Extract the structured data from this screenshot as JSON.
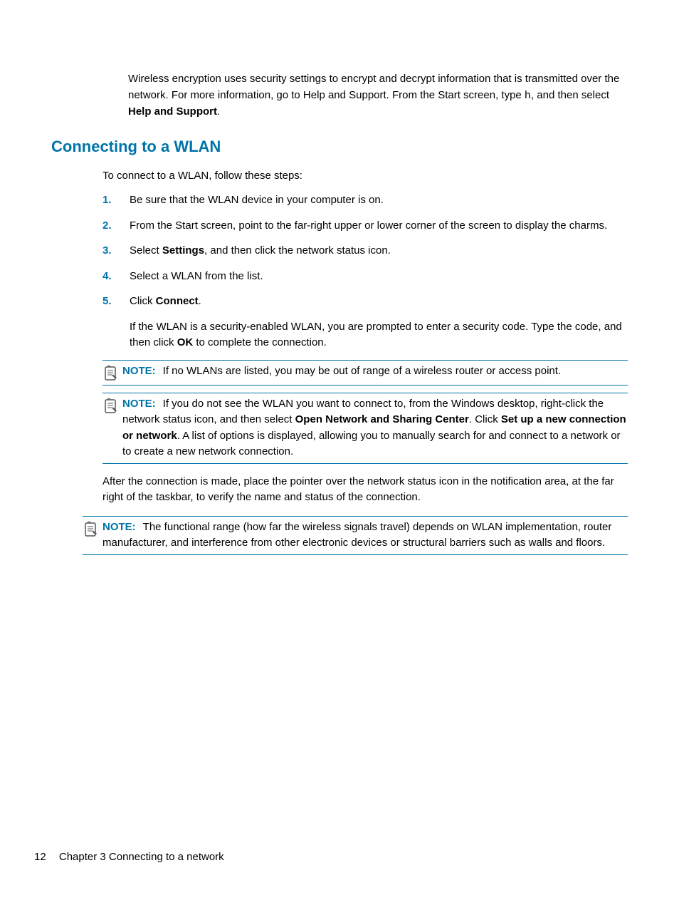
{
  "intro": {
    "text_before": "Wireless encryption uses security settings to encrypt and decrypt information that is transmitted over the network. For more information, go to Help and Support. From the Start screen, type ",
    "mono": "h",
    "text_after": ", and then select ",
    "bold": "Help and Support",
    "end": "."
  },
  "heading": "Connecting to a WLAN",
  "para1": "To connect to a WLAN, follow these steps:",
  "steps": {
    "s1": {
      "num": "1.",
      "text": "Be sure that the WLAN device in your computer is on."
    },
    "s2": {
      "num": "2.",
      "text": "From the Start screen, point to the far-right upper or lower corner of the screen to display the charms."
    },
    "s3": {
      "num": "3.",
      "before": "Select ",
      "bold": "Settings",
      "after": ", and then click the network status icon."
    },
    "s4": {
      "num": "4.",
      "text": "Select a WLAN from the list."
    },
    "s5": {
      "num": "5.",
      "before": "Click ",
      "bold": "Connect",
      "after": "."
    },
    "s5extra": {
      "before": "If the WLAN is a security-enabled WLAN, you are prompted to enter a security code. Type the code, and then click ",
      "bold": "OK",
      "after": " to complete the connection."
    }
  },
  "note1": {
    "label": "NOTE:",
    "text": "If no WLANs are listed, you may be out of range of a wireless router or access point."
  },
  "note2": {
    "label": "NOTE:",
    "before": "If you do not see the WLAN you want to connect to, from the Windows desktop, right-click the network status icon, and then select ",
    "bold1": "Open Network and Sharing Center",
    "mid": ". Click ",
    "bold2": "Set up a new connection or network",
    "after": ". A list of options is displayed, allowing you to manually search for and connect to a network or to create a new network connection."
  },
  "after_para": "After the connection is made, place the pointer over the network status icon in the notification area, at the far right of the taskbar, to verify the name and status of the connection.",
  "note3": {
    "label": "NOTE:",
    "text": "The functional range (how far the wireless signals travel) depends on WLAN implementation, router manufacturer, and interference from other electronic devices or structural barriers such as walls and floors."
  },
  "footer": {
    "page": "12",
    "chapter": "Chapter 3   Connecting to a network"
  }
}
